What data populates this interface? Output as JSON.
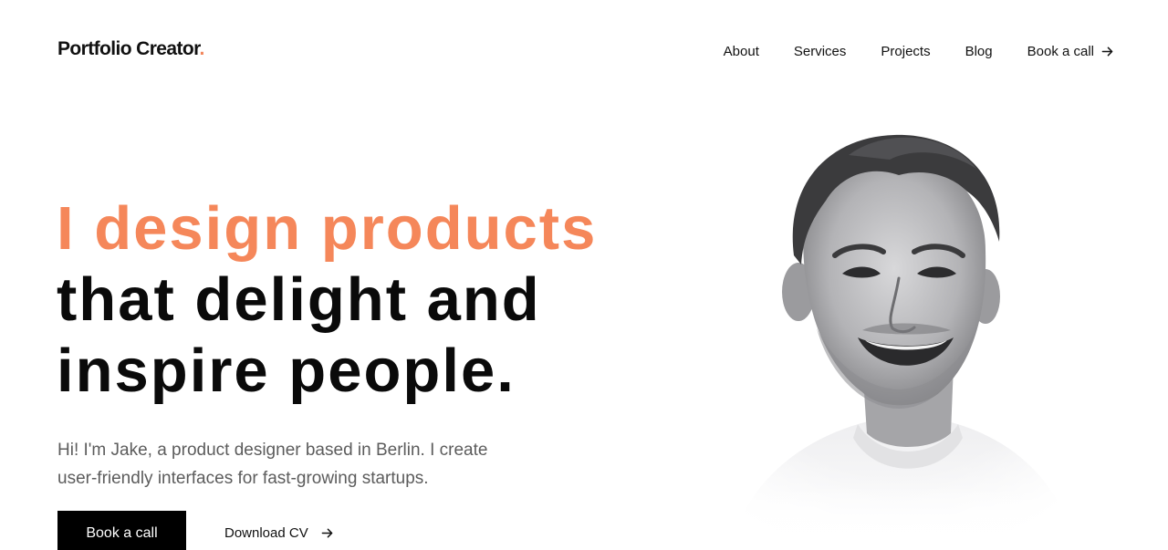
{
  "header": {
    "logo_text": "Portfolio Creator",
    "logo_dot": ".",
    "nav": [
      {
        "label": "About"
      },
      {
        "label": "Services"
      },
      {
        "label": "Projects"
      },
      {
        "label": "Blog"
      },
      {
        "label": "Book a call",
        "icon": "arrow-right-icon"
      }
    ]
  },
  "hero": {
    "title_line1": "I design products",
    "title_line2": "that delight and",
    "title_line3": "inspire people.",
    "intro_line1": "Hi! I'm Jake, a product designer based in Berlin. I create",
    "intro_line2": "user-friendly interfaces for fast-growing startups.",
    "primary_button": "Book a call",
    "secondary_button": "Download CV",
    "secondary_icon": "arrow-right-icon"
  },
  "colors": {
    "accent": "#f5875a",
    "text": "#0a0a0a",
    "muted": "#5c5c5c",
    "button_bg": "#000000"
  }
}
